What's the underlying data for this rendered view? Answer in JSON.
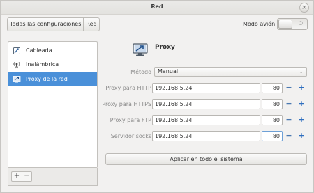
{
  "window": {
    "title": "Red"
  },
  "toolbar": {
    "crumbs": [
      "Todas las configuraciones",
      "Red"
    ],
    "airplane_label": "Modo avión",
    "airplane_state": "○"
  },
  "sidebar": {
    "items": [
      {
        "label": "Cableada",
        "icon": "wired-network-icon",
        "selected": false
      },
      {
        "label": "Inalámbrica",
        "icon": "wireless-network-icon",
        "selected": false
      },
      {
        "label": "Proxy de la red",
        "icon": "proxy-icon",
        "selected": true
      }
    ],
    "add_label": "+",
    "remove_label": "−"
  },
  "proxy": {
    "title": "Proxy",
    "method_label": "Método",
    "method_value": "Manual",
    "rows": [
      {
        "label": "Proxy para HTTP",
        "host": "192.168.5.24",
        "port": "80"
      },
      {
        "label": "Proxy para HTTPS",
        "host": "192.168.5.24",
        "port": "80"
      },
      {
        "label": "Proxy para FTP",
        "host": "192.168.5.24",
        "port": "80"
      },
      {
        "label": "Servidor socks",
        "host": "192.168.5.24",
        "port": "80"
      }
    ],
    "minus": "−",
    "plus": "+",
    "apply_label": "Aplicar en todo el sistema"
  },
  "colors": {
    "selection": "#4a90d9",
    "window_bg": "#f2f1f0",
    "stepper_blue": "#2f6fbf"
  }
}
